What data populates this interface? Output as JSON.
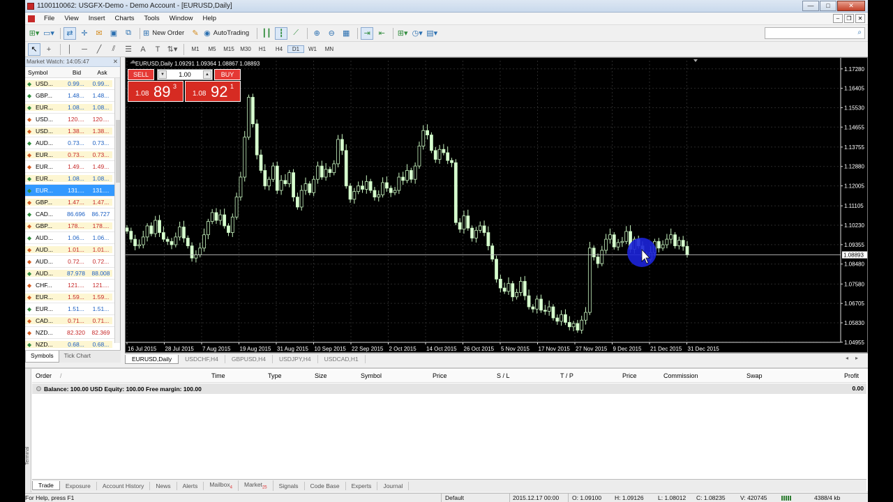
{
  "window": {
    "title": "1100110062: USGFX-Demo - Demo Account - [EURUSD,Daily]"
  },
  "menu": [
    "File",
    "View",
    "Insert",
    "Charts",
    "Tools",
    "Window",
    "Help"
  ],
  "toolbar": {
    "new_order": "New Order",
    "autotrading": "AutoTrading",
    "timeframes": [
      "M1",
      "M5",
      "M15",
      "M30",
      "H1",
      "H4",
      "D1",
      "W1",
      "MN"
    ],
    "active_timeframe": "D1"
  },
  "market_watch": {
    "header": "Market Watch: 14:05:47",
    "cols": {
      "symbol": "Symbol",
      "bid": "Bid",
      "ask": "Ask"
    },
    "rows": [
      {
        "sym": "USD...",
        "bid": "0.99...",
        "ask": "0.99...",
        "dir": "up"
      },
      {
        "sym": "GBP...",
        "bid": "1.48...",
        "ask": "1.48...",
        "dir": "up"
      },
      {
        "sym": "EUR...",
        "bid": "1.08...",
        "ask": "1.08...",
        "dir": "up"
      },
      {
        "sym": "USD...",
        "bid": "120....",
        "ask": "120....",
        "dir": "down"
      },
      {
        "sym": "USD...",
        "bid": "1.38...",
        "ask": "1.38...",
        "dir": "down"
      },
      {
        "sym": "AUD...",
        "bid": "0.73...",
        "ask": "0.73...",
        "dir": "up"
      },
      {
        "sym": "EUR...",
        "bid": "0.73...",
        "ask": "0.73...",
        "dir": "down"
      },
      {
        "sym": "EUR...",
        "bid": "1.49...",
        "ask": "1.49...",
        "dir": "down"
      },
      {
        "sym": "EUR...",
        "bid": "1.08...",
        "ask": "1.08...",
        "dir": "up"
      },
      {
        "sym": "EUR...",
        "bid": "131....",
        "ask": "131....",
        "dir": "up",
        "selected": true
      },
      {
        "sym": "GBP...",
        "bid": "1.47...",
        "ask": "1.47...",
        "dir": "down"
      },
      {
        "sym": "CAD...",
        "bid": "86.696",
        "ask": "86.727",
        "dir": "up"
      },
      {
        "sym": "GBP...",
        "bid": "178....",
        "ask": "178....",
        "dir": "down"
      },
      {
        "sym": "AUD...",
        "bid": "1.06...",
        "ask": "1.06...",
        "dir": "up"
      },
      {
        "sym": "AUD...",
        "bid": "1.01...",
        "ask": "1.01...",
        "dir": "down"
      },
      {
        "sym": "AUD...",
        "bid": "0.72...",
        "ask": "0.72...",
        "dir": "down"
      },
      {
        "sym": "AUD...",
        "bid": "87.978",
        "ask": "88.008",
        "dir": "up"
      },
      {
        "sym": "CHF...",
        "bid": "121....",
        "ask": "121....",
        "dir": "down"
      },
      {
        "sym": "EUR...",
        "bid": "1.59...",
        "ask": "1.59...",
        "dir": "down"
      },
      {
        "sym": "EUR...",
        "bid": "1.51...",
        "ask": "1.51...",
        "dir": "up"
      },
      {
        "sym": "CAD...",
        "bid": "0.71...",
        "ask": "0.71...",
        "dir": "down"
      },
      {
        "sym": "NZD...",
        "bid": "82.320",
        "ask": "82.369",
        "dir": "down"
      },
      {
        "sym": "NZD...",
        "bid": "0.68...",
        "ask": "0.68...",
        "dir": "up"
      }
    ],
    "tabs": [
      "Symbols",
      "Tick Chart"
    ]
  },
  "chart": {
    "info": "EURUSD,Daily  1.09291 1.09364 1.08867 1.08893",
    "current_price": "1.08893",
    "oct": {
      "sell": "SELL",
      "buy": "BUY",
      "lot": "1.00",
      "sell_small": "1.08",
      "sell_big": "89",
      "sell_sup": "3",
      "buy_small": "1.08",
      "buy_big": "92",
      "buy_sup": "1"
    },
    "price_labels": [
      "1.17280",
      "1.16405",
      "1.15530",
      "1.14655",
      "1.13755",
      "1.12880",
      "1.12005",
      "1.11105",
      "1.10230",
      "1.09355",
      "1.08480",
      "1.07580",
      "1.06705",
      "1.05830",
      "1.04955"
    ],
    "date_labels": [
      "16 Jul 2015",
      "28 Jul 2015",
      "7 Aug 2015",
      "19 Aug 2015",
      "31 Aug 2015",
      "10 Sep 2015",
      "22 Sep 2015",
      "2 Oct 2015",
      "14 Oct 2015",
      "26 Oct 2015",
      "5 Nov 2015",
      "17 Nov 2015",
      "27 Nov 2015",
      "9 Dec 2015",
      "21 Dec 2015",
      "31 Dec 2015"
    ],
    "tabs": [
      "EURUSD,Daily",
      "USDCHF,H4",
      "GBPUSD,H4",
      "USDJPY,H4",
      "USDCAD,H1"
    ],
    "colors": {
      "bg": "#000000",
      "bull": "#000000",
      "bear": "#d8ffd0",
      "wick": "#c8f5c0",
      "grid": "#2a2a2a"
    }
  },
  "chart_data": {
    "type": "candlestick",
    "symbol": "EURUSD",
    "timeframe": "Daily",
    "last_bar": {
      "open": 1.09291,
      "high": 1.09364,
      "low": 1.08867,
      "close": 1.08893
    },
    "ylim": [
      1.0495,
      1.1765
    ],
    "closes": [
      1.0996,
      1.096,
      1.093,
      1.0935,
      1.097,
      1.102,
      1.0985,
      1.1045,
      1.099,
      1.096,
      1.095,
      1.0935,
      1.097,
      1.1015,
      1.0965,
      1.093,
      1.0875,
      1.089,
      1.092,
      1.098,
      1.104,
      1.108,
      1.1045,
      1.107,
      1.102,
      1.099,
      1.106,
      1.115,
      1.124,
      1.142,
      1.16,
      1.148,
      1.134,
      1.127,
      1.12,
      1.123,
      1.129,
      1.118,
      1.1225,
      1.121,
      1.126,
      1.115,
      1.1105,
      1.118,
      1.121,
      1.117,
      1.123,
      1.129,
      1.124,
      1.1275,
      1.126,
      1.13,
      1.141,
      1.136,
      1.12,
      1.114,
      1.1175,
      1.12,
      1.1185,
      1.122,
      1.118,
      1.115,
      1.116,
      1.1215,
      1.119,
      1.117,
      1.118,
      1.124,
      1.1225,
      1.127,
      1.123,
      1.129,
      1.138,
      1.145,
      1.143,
      1.136,
      1.132,
      1.1365,
      1.135,
      1.1315,
      1.1305,
      1.1035,
      1.1005,
      1.1065,
      1.101,
      1.0965,
      1.1,
      1.102,
      1.099,
      1.093,
      1.087,
      1.078,
      1.074,
      1.0725,
      1.076,
      1.07,
      1.072,
      1.077,
      1.0705,
      1.0655,
      1.0645,
      1.069,
      1.064,
      1.0635,
      1.0655,
      1.0605,
      1.059,
      1.062,
      1.0585,
      1.0565,
      1.058,
      1.055,
      1.0595,
      1.063,
      1.092,
      1.088,
      1.085,
      1.091,
      1.096,
      1.098,
      1.0925,
      1.0945,
      1.095,
      1.0995,
      1.0915,
      1.096,
      1.093,
      1.088,
      1.087,
      1.09,
      1.095,
      1.092,
      1.0935,
      1.096,
      1.098,
      1.093,
      1.0955,
      1.0928,
      1.0889
    ]
  },
  "terminal": {
    "cols": [
      "Order",
      "/",
      "Time",
      "Type",
      "Size",
      "Symbol",
      "Price",
      "S / L",
      "T / P",
      "Price",
      "Commission",
      "Swap",
      "Profit"
    ],
    "balance": "Balance: 100.00 USD  Equity: 100.00  Free margin: 100.00",
    "profit": "0.00",
    "side_label": "Terminal",
    "tabs": [
      {
        "label": "Trade",
        "badge": ""
      },
      {
        "label": "Exposure",
        "badge": ""
      },
      {
        "label": "Account History",
        "badge": ""
      },
      {
        "label": "News",
        "badge": ""
      },
      {
        "label": "Alerts",
        "badge": ""
      },
      {
        "label": "Mailbox",
        "badge": "4"
      },
      {
        "label": "Market",
        "badge": "25"
      },
      {
        "label": "Signals",
        "badge": ""
      },
      {
        "label": "Code Base",
        "badge": ""
      },
      {
        "label": "Experts",
        "badge": ""
      },
      {
        "label": "Journal",
        "badge": ""
      }
    ]
  },
  "status": {
    "help": "For Help, press F1",
    "profile": "Default",
    "time": "2015.12.17 00:00",
    "open": "O: 1.09100",
    "high": "H: 1.09126",
    "low": "L: 1.08012",
    "close": "C: 1.08235",
    "volume": "V: 420745",
    "traffic": "4388/4 kb"
  }
}
